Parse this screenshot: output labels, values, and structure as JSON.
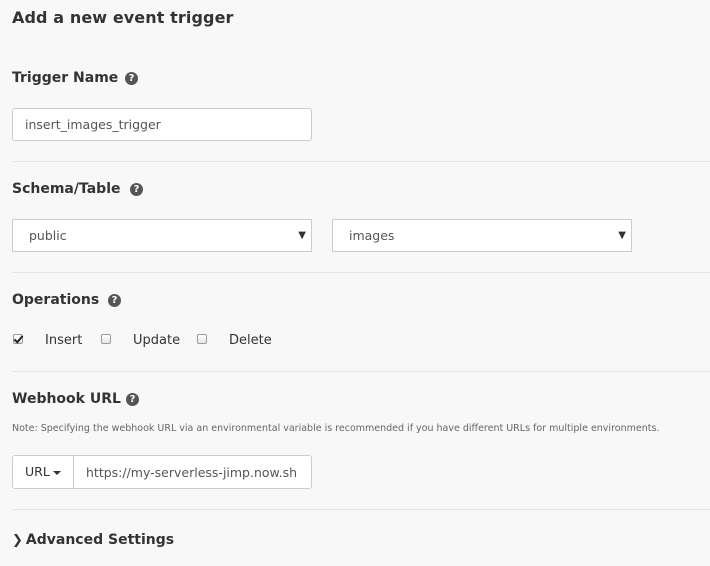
{
  "page": {
    "title": "Add a new event trigger"
  },
  "trigger_name": {
    "label": "Trigger Name",
    "value": "insert_images_trigger"
  },
  "schema_table": {
    "label": "Schema/Table",
    "schema_selected": "public",
    "table_selected": "images"
  },
  "operations": {
    "label": "Operations",
    "items": [
      {
        "label": "Insert",
        "checked": true
      },
      {
        "label": "Update",
        "checked": false
      },
      {
        "label": "Delete",
        "checked": false
      }
    ]
  },
  "webhook": {
    "label": "Webhook URL",
    "note": "Note: Specifying the webhook URL via an environmental variable is recommended if you have different URLs for multiple environments.",
    "type_dropdown": "URL",
    "value": "https://my-serverless-jimp.now.sh"
  },
  "advanced": {
    "label": "Advanced Settings"
  },
  "icons": {
    "help": "question-circle-icon",
    "select_arrow": "caret-down-icon",
    "expand": "chevron-right-icon"
  }
}
